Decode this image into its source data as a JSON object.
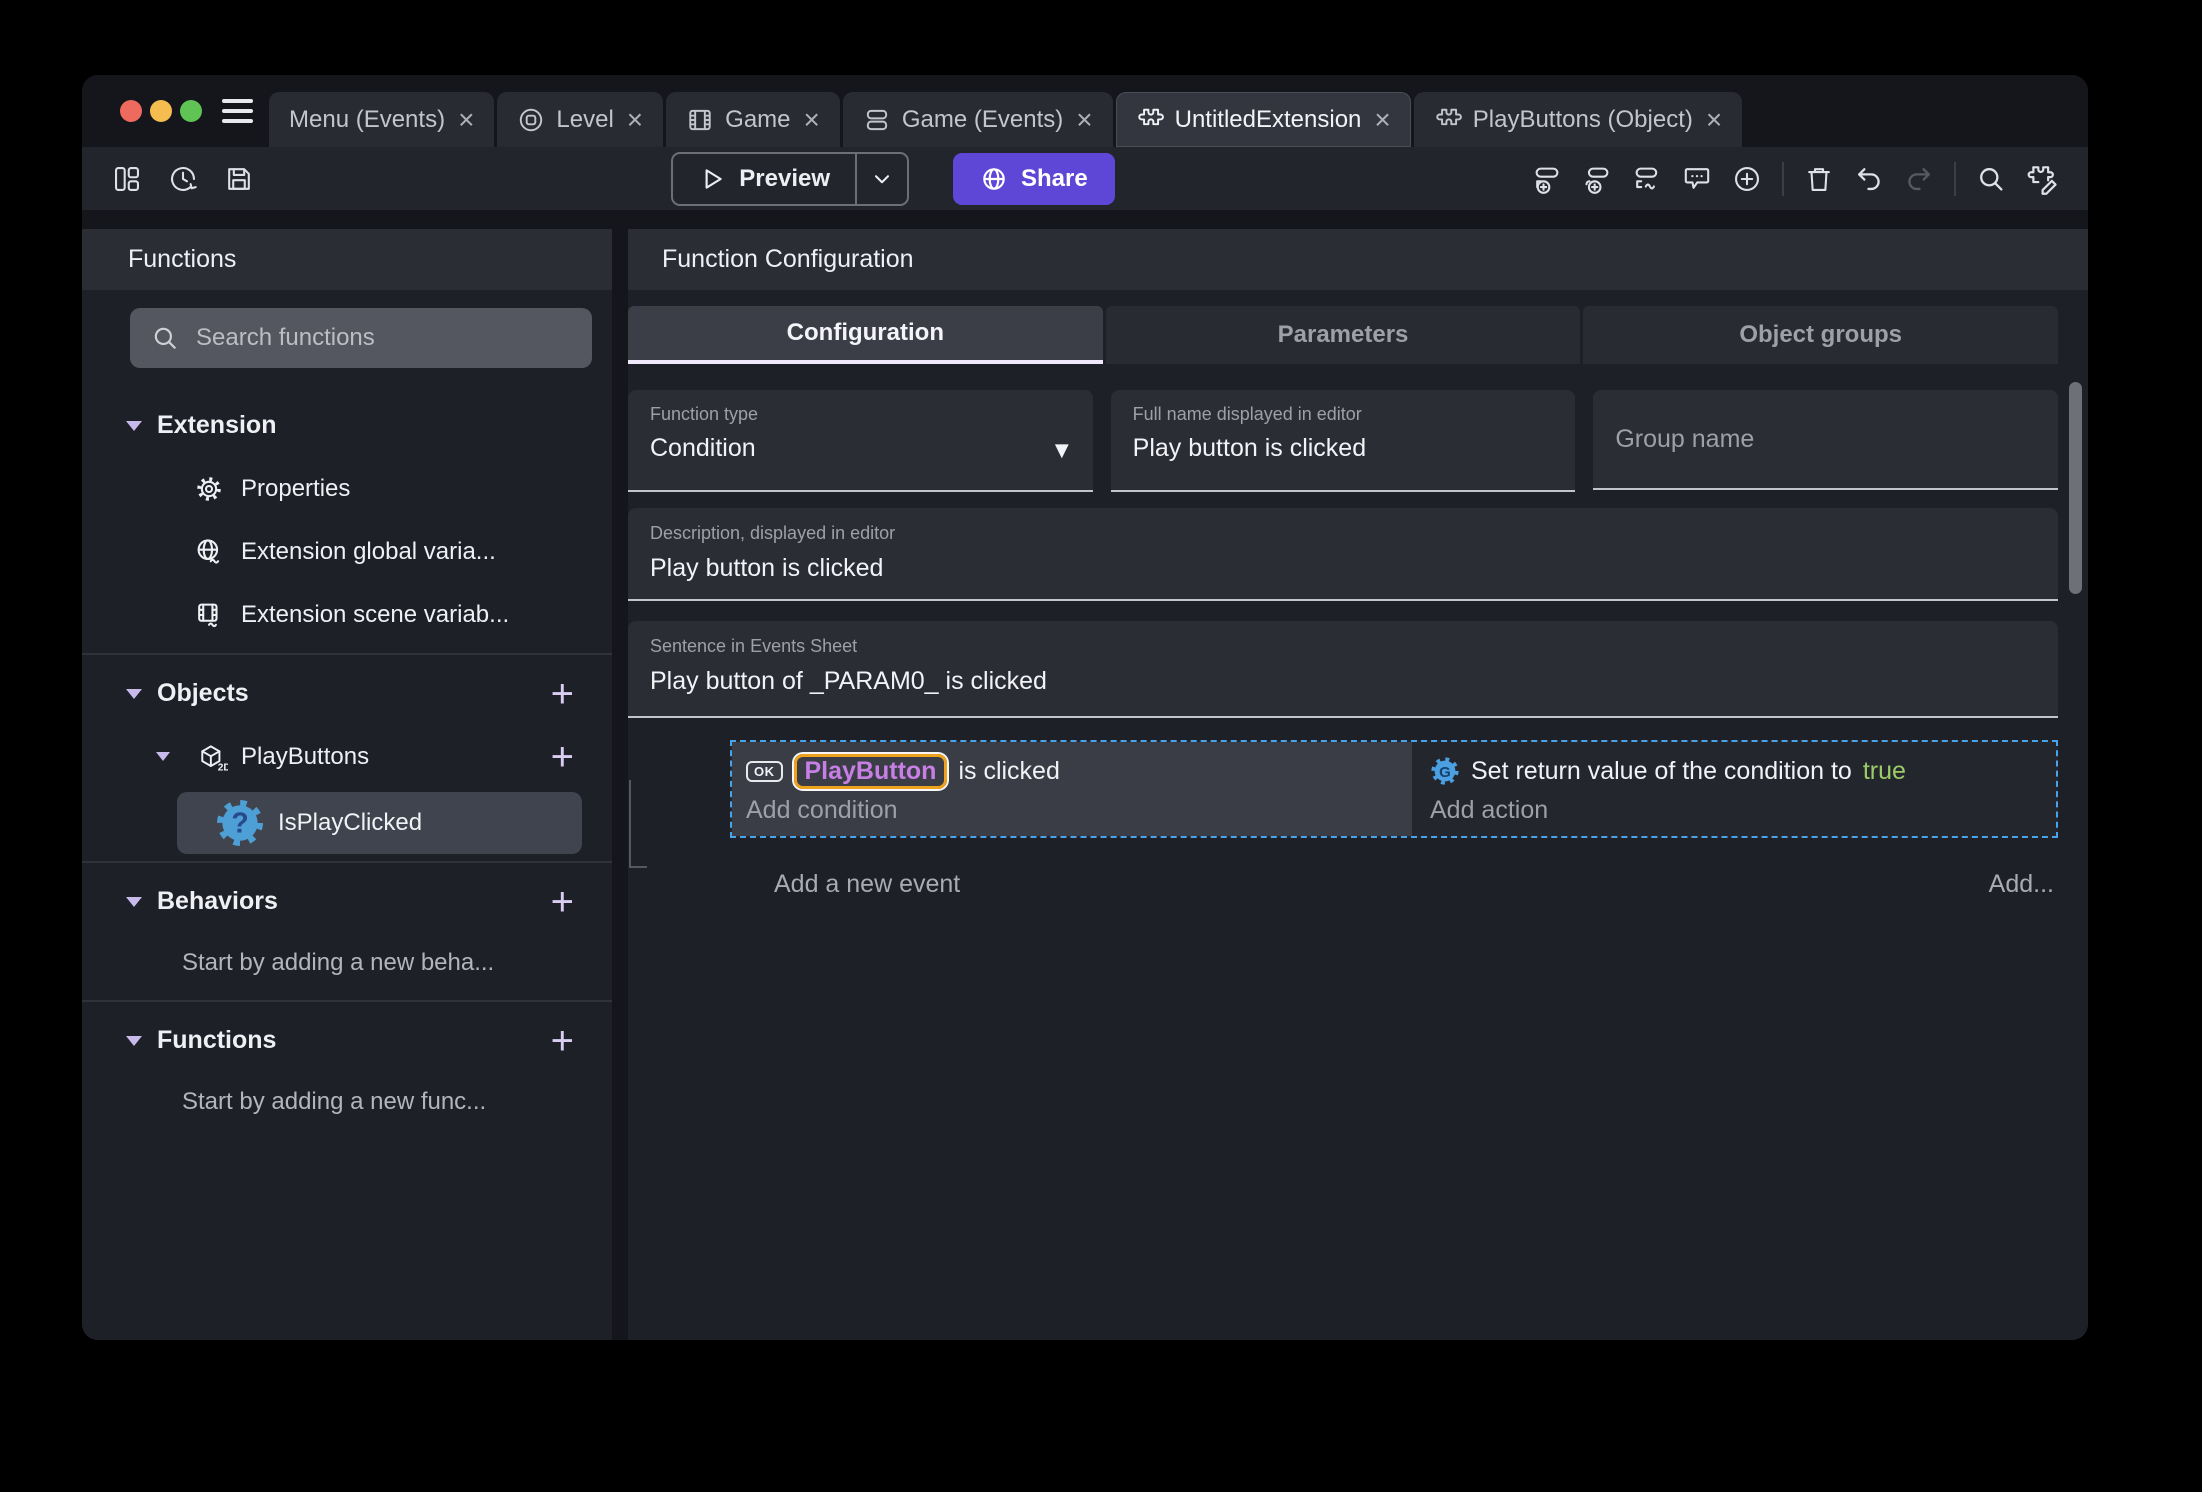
{
  "tab_bar": {
    "tabs": [
      {
        "label": "Menu (Events)"
      },
      {
        "label": "Level"
      },
      {
        "label": "Game"
      },
      {
        "label": "Game (Events)"
      },
      {
        "label": "UntitledExtension"
      },
      {
        "label": "PlayButtons (Object)"
      }
    ],
    "close_glyph": "×"
  },
  "toolbar": {
    "preview_label": "Preview",
    "share_label": "Share"
  },
  "sidebar": {
    "header": "Functions",
    "search_placeholder": "Search functions",
    "extension_section": "Extension",
    "properties": "Properties",
    "global_variables": "Extension global varia...",
    "scene_variables": "Extension scene variab...",
    "objects_section": "Objects",
    "playbuttons": "PlayButtons",
    "function_item": "IsPlayClicked",
    "behaviors_section": "Behaviors",
    "behaviors_empty": "Start by adding a new beha...",
    "functions_section": "Functions",
    "functions_empty": "Start by adding a new func..."
  },
  "main": {
    "header": "Function Configuration",
    "tabs": [
      {
        "label": "Configuration"
      },
      {
        "label": "Parameters"
      },
      {
        "label": "Object groups"
      }
    ],
    "function_type_label": "Function type",
    "function_type_value": "Condition",
    "full_name_label": "Full name displayed in editor",
    "full_name_value": "Play button is clicked",
    "group_name_placeholder": "Group name",
    "description_label": "Description, displayed in editor",
    "description_value": "Play button is clicked",
    "sentence_label": "Sentence in Events Sheet",
    "sentence_value": "Play button of _PARAM0_ is clicked",
    "events": {
      "condition_ok_badge": "OK",
      "condition_object": "PlayButton",
      "condition_text": "is clicked",
      "add_condition": "Add condition",
      "action_text": "Set return value of the condition to",
      "action_value": "true",
      "add_action": "Add action",
      "add_new_event": "Add a new event",
      "add_more": "Add..."
    }
  },
  "icons": {
    "dropdown_arrow": "▼",
    "plus": "+",
    "hamburger": "css-three-lines",
    "project_manager": "svg-panels",
    "history": "svg-clock-arrow",
    "save": "svg-floppy",
    "play": "svg-triangle",
    "chevron_down": "svg-chevron",
    "globe": "svg-globe",
    "add_event": "svg-row-plus",
    "add_subevent": "svg-row-plus-indent",
    "add_other_event": "svg-row-squiggle",
    "comment": "svg-speech-bubble",
    "circle_plus": "svg-circle-plus",
    "trash": "svg-trash",
    "undo": "svg-arrow-left-curve",
    "redo": "svg-arrow-right-curve",
    "search": "svg-magnifier",
    "edit_extension": "svg-puzzle-pencil",
    "scene": "svg-circle-square",
    "film": "svg-filmstrip",
    "events_sheet": "svg-stacked-rows",
    "puzzle": "svg-puzzle",
    "gear": "svg-gear",
    "cube_2d": "svg-cube-2d",
    "function_gear_question": "svg-blue-gear-question",
    "action_gear": "svg-blue-gear"
  },
  "colors": {
    "accent_purple": "#5e47d6",
    "object_name_purple": "#c77fe3",
    "object_border_orange": "#eca21d",
    "boolean_true_green": "#9ccc65",
    "selection_dashed_blue": "#4aa3e8",
    "traffic_red": "#ee6a5f",
    "traffic_yellow": "#f5bd4f",
    "traffic_green": "#5fc454"
  }
}
